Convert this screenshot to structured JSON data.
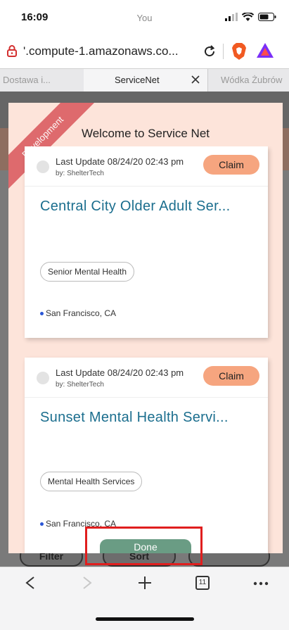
{
  "status_bar": {
    "time": "16:09",
    "center_label": "You"
  },
  "url_bar": {
    "url": "'.compute-1.amazonaws.co..."
  },
  "tabs": [
    {
      "label": "Dostawa i..."
    },
    {
      "label": "ServiceNet"
    },
    {
      "label": "Wódka Żubrów"
    }
  ],
  "page_behind": {
    "filter_label": "Filter",
    "sort_label": "Sort"
  },
  "modal": {
    "ribbon": "Development",
    "title": "Welcome to Service Net",
    "cards": [
      {
        "last_update": "Last Update 08/24/20 02:43 pm",
        "by": "by: ShelterTech",
        "claim_label": "Claim",
        "name": "Central City Older Adult Ser...",
        "tag": "Senior Mental Health",
        "location": "San Francisco, CA"
      },
      {
        "last_update": "Last Update 08/24/20 02:43 pm",
        "by": "by: ShelterTech",
        "claim_label": "Claim",
        "name": "Sunset Mental Health Servi...",
        "tag": "Mental Health Services",
        "location": "San Francisco, CA"
      }
    ],
    "done_label": "Done"
  },
  "toolbar": {
    "tab_count": "11"
  },
  "colors": {
    "accent": "#1b6e8e",
    "claim": "#f6a57f",
    "modal_bg": "#fde4da",
    "done": "#6a9c84",
    "highlight": "#e01e1e"
  }
}
